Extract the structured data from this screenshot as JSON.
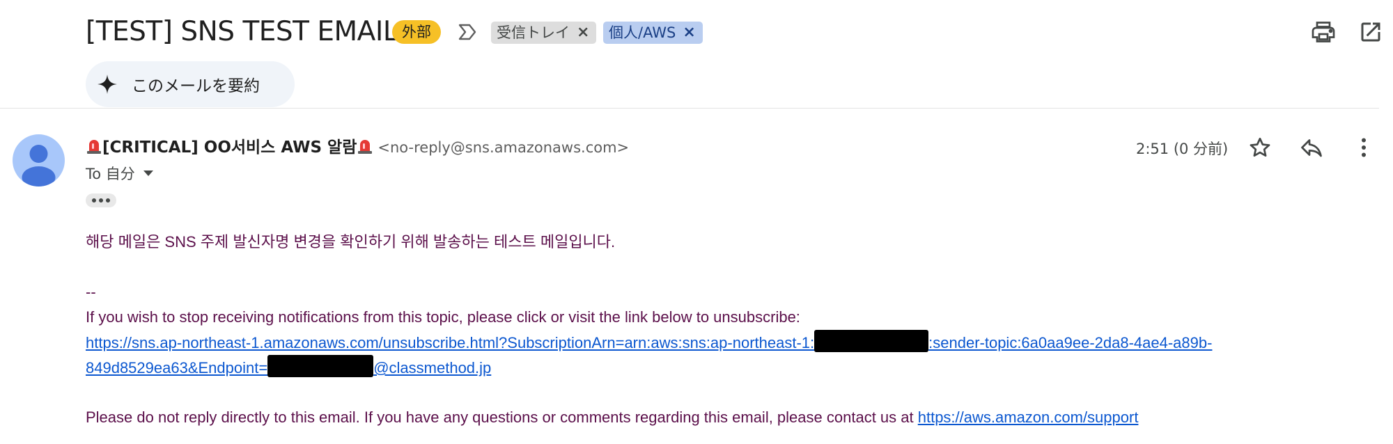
{
  "subject": "[TEST] SNS TEST EMAIL",
  "external_badge": "外部",
  "labels": [
    {
      "text": "受信トレイ",
      "remove": "×"
    },
    {
      "text": "個人/AWS",
      "remove": "×"
    }
  ],
  "summarize_label": "このメールを要約",
  "sender": {
    "name": "[CRITICAL] OO서비스 AWS 알람",
    "email": "<no-reply@sns.amazonaws.com>"
  },
  "time": "2:51 (0 分前)",
  "recipient": "To 自分",
  "body": {
    "line1": "해당 메일은 SNS 주제 발신자명 변경을 확인하기 위해 발송하는 테스트 메일입니다.",
    "separator": "--",
    "unsubscribe_intro": "If you wish to stop receiving notifications from this topic, please click or visit the link below to unsubscribe:",
    "unsub_link_part1": "https://sns.ap-northeast-1.amazonaws.com/unsubscribe.html?SubscriptionArn=arn:aws:sns:ap-northeast-1:",
    "unsub_link_part2": ":sender-topic:6a0aa9ee-2da8-4ae4-a89b-",
    "unsub_link_part3": "849d8529ea63&Endpoint=",
    "unsub_link_part4": "@classmethod.jp",
    "support_text": "Please do not reply directly to this email. If you have any questions or comments regarding this email, please contact us at ",
    "support_link": "https://aws.amazon.com/support"
  },
  "colors": {
    "external_badge": "#f6c026",
    "label_inbox": "#dddddd",
    "label_aws": "#b9cdf0",
    "body_text": "#5b0f4a",
    "link": "#0b57d0",
    "avatar": "#a8c7fa"
  },
  "icons": [
    "importance-marker-icon",
    "print-icon",
    "open-in-new-window-icon",
    "sparkle-icon",
    "siren-icon",
    "star-icon",
    "reply-icon",
    "more-vert-icon",
    "caret-down-icon",
    "ellipsis-icon",
    "avatar-person-icon"
  ]
}
